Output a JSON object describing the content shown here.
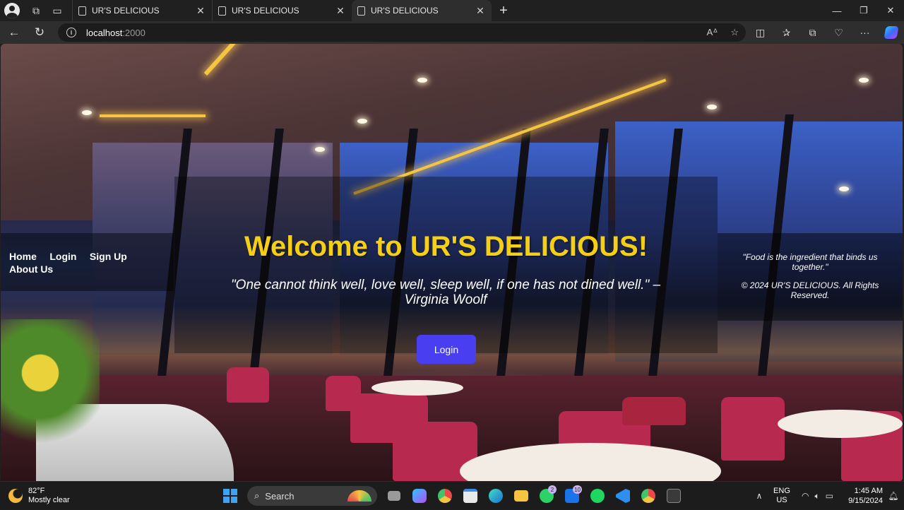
{
  "browser": {
    "tabs": [
      {
        "title": "UR'S DELICIOUS",
        "active": false
      },
      {
        "title": "UR'S DELICIOUS",
        "active": false
      },
      {
        "title": "UR'S DELICIOUS",
        "active": true
      }
    ],
    "address": {
      "host": "localhost",
      "port": ":2000"
    }
  },
  "page": {
    "nav": [
      "Home",
      "Login",
      "Sign Up",
      "About Us"
    ],
    "hero": {
      "title": "Welcome to UR'S DELICIOUS!",
      "quote": "\"One cannot think well, love well, sleep well, if one has not dined well.\" – Virginia Woolf",
      "button": "Login"
    },
    "footer": {
      "quote": "\"Food is the ingredient that binds us together.\"",
      "copyright": "© 2024 UR'S DELICIOUS. All Rights Reserved."
    },
    "colors": {
      "title": "#f5cf14",
      "button": "#4a3ff0"
    }
  },
  "taskbar": {
    "weather": {
      "temp": "82°F",
      "condition": "Mostly clear"
    },
    "search_placeholder": "Search",
    "badges": {
      "whatsapp": "2",
      "outlook": "10"
    },
    "lang": {
      "line1": "ENG",
      "line2": "US"
    },
    "clock": {
      "time": "1:45 AM",
      "date": "9/15/2024"
    }
  }
}
